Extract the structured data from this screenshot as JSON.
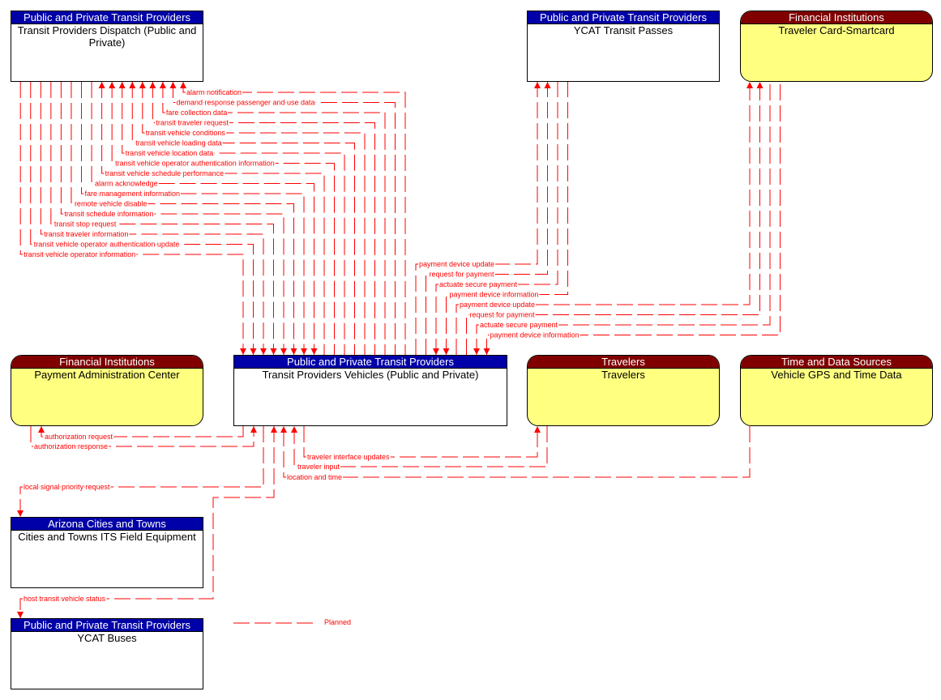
{
  "elements": {
    "dispatch": {
      "group": "Public and Private Transit Providers",
      "name": "Transit Providers Dispatch (Public and Private)"
    },
    "passes": {
      "group": "Public and Private Transit Providers",
      "name": "YCAT Transit Passes"
    },
    "smartcard": {
      "group": "Financial Institutions",
      "name": "Traveler Card-Smartcard"
    },
    "pac": {
      "group": "Financial Institutions",
      "name": "Payment Administration Center"
    },
    "vehicles": {
      "group": "Public and Private Transit Providers",
      "name": "Transit Providers Vehicles (Public and Private)"
    },
    "travelers": {
      "group": "Travelers",
      "name": "Travelers"
    },
    "gps": {
      "group": "Time and Data Sources",
      "name": "Vehicle GPS and Time Data"
    },
    "cities": {
      "group": "Arizona Cities and Towns",
      "name": "Cities and Towns ITS Field Equipment"
    },
    "buses": {
      "group": "Public and Private Transit Providers",
      "name": "YCAT Buses"
    }
  },
  "dispatch_flows": [
    {
      "label": "alarm notification",
      "to": "dispatch"
    },
    {
      "label": "demand response passenger and use data",
      "to": "dispatch"
    },
    {
      "label": "fare collection data",
      "to": "dispatch"
    },
    {
      "label": "transit traveler request",
      "to": "dispatch"
    },
    {
      "label": "transit vehicle conditions",
      "to": "dispatch"
    },
    {
      "label": "transit vehicle loading data",
      "to": "dispatch"
    },
    {
      "label": "transit vehicle location data",
      "to": "dispatch"
    },
    {
      "label": "transit vehicle operator authentication information",
      "to": "dispatch"
    },
    {
      "label": "transit vehicle schedule performance",
      "to": "dispatch"
    },
    {
      "label": "alarm acknowledge",
      "to": "vehicles"
    },
    {
      "label": "fare management information",
      "to": "vehicles"
    },
    {
      "label": "remote vehicle disable",
      "to": "vehicles"
    },
    {
      "label": "transit schedule information",
      "to": "vehicles"
    },
    {
      "label": "transit stop request",
      "to": "vehicles"
    },
    {
      "label": "transit traveler information",
      "to": "vehicles"
    },
    {
      "label": "transit vehicle operator authentication update",
      "to": "vehicles"
    },
    {
      "label": "transit vehicle operator information",
      "to": "vehicles"
    }
  ],
  "passes_flows": [
    {
      "label": "payment device update",
      "to": "passes"
    },
    {
      "label": "request for payment",
      "to": "passes"
    },
    {
      "label": "actuate secure payment",
      "to": "vehicles"
    },
    {
      "label": "payment device information",
      "to": "vehicles"
    }
  ],
  "smartcard_flows": [
    {
      "label": "payment device update",
      "to": "smartcard"
    },
    {
      "label": "request for payment",
      "to": "smartcard"
    },
    {
      "label": "actuate secure payment",
      "to": "vehicles"
    },
    {
      "label": "payment device information",
      "to": "vehicles"
    }
  ],
  "other_flows": [
    {
      "label": "authorization request",
      "to": "pac"
    },
    {
      "label": "authorization response",
      "to": "vehicles"
    },
    {
      "label": "local signal priority request",
      "to": "cities"
    },
    {
      "label": "host transit vehicle status",
      "to": "buses"
    },
    {
      "label": "traveler interface updates",
      "to": "travelers"
    },
    {
      "label": "traveler input",
      "to": "vehicles"
    },
    {
      "label": "location and time",
      "to": "vehicles"
    }
  ],
  "legend": {
    "label": "Planned"
  },
  "colors": {
    "flow": "#ff0000",
    "blue_header": "#0000a8",
    "red_header": "#800000",
    "yellow_body": "#ffff80"
  }
}
